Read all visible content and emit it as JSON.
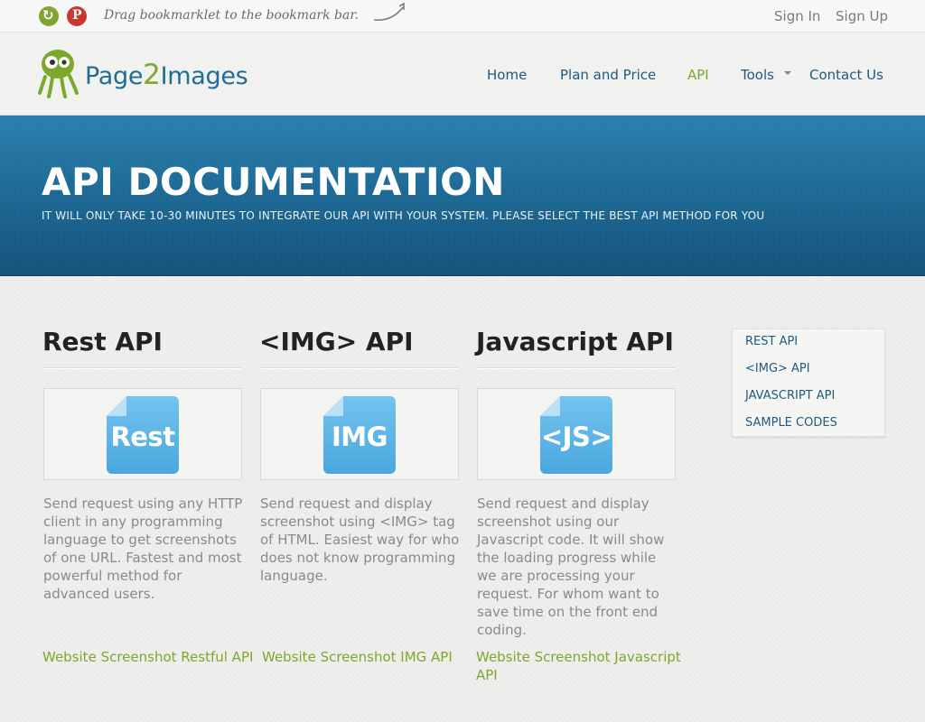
{
  "topbar": {
    "share_icon": "share-icon",
    "pinterest_icon": "pinterest-icon",
    "bookmarklet_text": "Drag bookmarklet to the bookmark bar.",
    "sign_in": "Sign In",
    "sign_up": "Sign Up"
  },
  "header": {
    "logo_part1": "Page",
    "logo_num": "2",
    "logo_part2": "Images",
    "nav": [
      {
        "label": "Home"
      },
      {
        "label": "Plan and Price"
      },
      {
        "label": "API"
      },
      {
        "label": "Tools"
      },
      {
        "label": "Contact Us"
      }
    ],
    "active_nav": "API"
  },
  "banner": {
    "title": "API DOCUMENTATION",
    "subtitle": "IT WILL ONLY TAKE 10-30 MINUTES TO INTEGRATE OUR API WITH YOUR SYSTEM. PLEASE SELECT THE BEST API METHOD FOR YOU"
  },
  "apis": [
    {
      "title": "Rest API",
      "icon_label": "Rest",
      "description": "Send request using any HTTP client in any programming language to get screenshots of one URL. Fastest and most powerful method for advanced users.",
      "link": "Website Screenshot Restful API"
    },
    {
      "title": "<IMG> API",
      "icon_label": "IMG",
      "description": "Send request and display screenshot using <IMG> tag of HTML. Easiest way for who does not know programming language.",
      "link": "Website Screenshot IMG API"
    },
    {
      "title": "Javascript API",
      "icon_label": "<JS>",
      "description": "Send request and display screenshot using our Javascript code. It will show the loading progress while we are processing your request. For whom want to save time on the front end coding.",
      "link": "Website Screenshot Javascript API"
    }
  ],
  "sidemenu": [
    {
      "label": "REST API"
    },
    {
      "label": "<IMG> API"
    },
    {
      "label": "JAVASCRIPT API"
    },
    {
      "label": "SAMPLE CODES"
    }
  ],
  "colors": {
    "brand_blue": "#1f6d95",
    "brand_green": "#7ca82b",
    "banner_blue": "#1d6a97"
  }
}
